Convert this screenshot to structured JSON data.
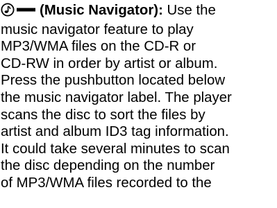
{
  "section": {
    "icons": [
      "music-note-circle-icon",
      "dash-bar-icon"
    ],
    "heading": "(Music Navigator):",
    "first_line_rest": " Use the",
    "lines": [
      "music navigator feature to play",
      "MP3/WMA files on the CD-R or",
      "CD-RW in order by artist or album.",
      "Press the pushbutton located below",
      "the music navigator label. The player",
      "scans the disc to sort the files by",
      "artist and album ID3 tag information.",
      "It could take several minutes to scan",
      "the disc depending on the number",
      "of MP3/WMA files recorded to the"
    ]
  }
}
